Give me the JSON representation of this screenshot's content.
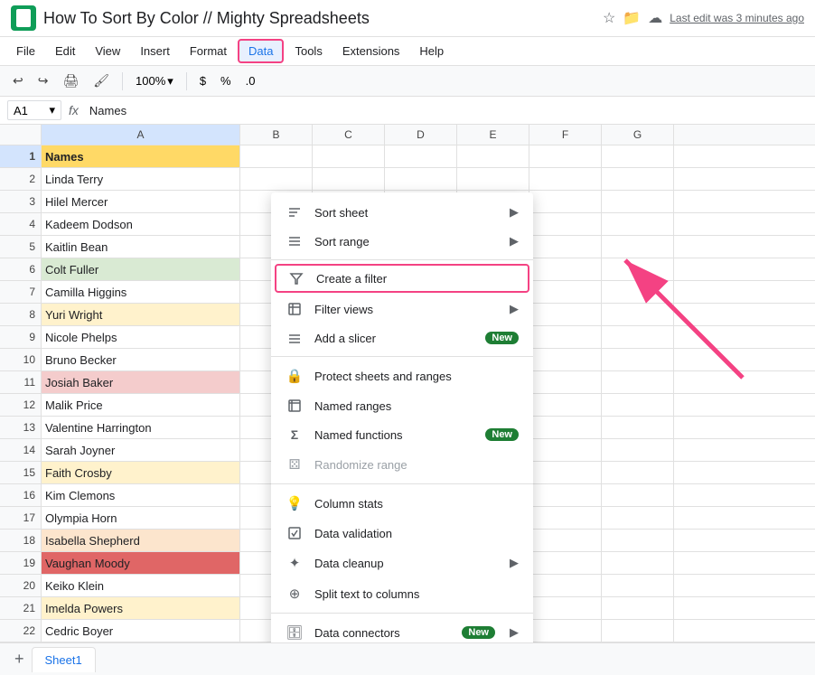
{
  "title": "How To Sort By Color // Mighty Spreadsheets",
  "lastEdit": "Last edit was 3 minutes ago",
  "menu": {
    "items": [
      "File",
      "Edit",
      "View",
      "Insert",
      "Format",
      "Data",
      "Tools",
      "Extensions",
      "Help"
    ],
    "activeItem": "Data"
  },
  "toolbar": {
    "zoom": "100%",
    "currency": "$",
    "percent": "%",
    "decimal": ".0"
  },
  "formulaBar": {
    "cellRef": "A1",
    "cellContent": "Names"
  },
  "columns": {
    "headers": [
      "A",
      "B",
      "C",
      "D",
      "E",
      "F",
      "G"
    ]
  },
  "rows": [
    {
      "num": 1,
      "a": "Names",
      "color": "header"
    },
    {
      "num": 2,
      "a": "Linda Terry",
      "color": ""
    },
    {
      "num": 3,
      "a": "Hilel Mercer",
      "color": ""
    },
    {
      "num": 4,
      "a": "Kadeem Dodson",
      "color": ""
    },
    {
      "num": 5,
      "a": "Kaitlin Bean",
      "color": ""
    },
    {
      "num": 6,
      "a": "Colt Fuller",
      "color": "green"
    },
    {
      "num": 7,
      "a": "Camilla Higgins",
      "color": ""
    },
    {
      "num": 8,
      "a": "Yuri Wright",
      "color": "yellow"
    },
    {
      "num": 9,
      "a": "Nicole Phelps",
      "color": ""
    },
    {
      "num": 10,
      "a": "Bruno Becker",
      "color": ""
    },
    {
      "num": 11,
      "a": "Josiah Baker",
      "color": "salmon"
    },
    {
      "num": 12,
      "a": "Malik Price",
      "color": ""
    },
    {
      "num": 13,
      "a": "Valentine Harrington",
      "color": ""
    },
    {
      "num": 14,
      "a": "Sarah Joyner",
      "color": ""
    },
    {
      "num": 15,
      "a": "Faith Crosby",
      "color": "yellow"
    },
    {
      "num": 16,
      "a": "Kim Clemons",
      "color": ""
    },
    {
      "num": 17,
      "a": "Olympia Horn",
      "color": ""
    },
    {
      "num": 18,
      "a": "Isabella Shepherd",
      "color": "orange"
    },
    {
      "num": 19,
      "a": "Vaughan Moody",
      "color": "red"
    },
    {
      "num": 20,
      "a": "Keiko Klein",
      "color": ""
    },
    {
      "num": 21,
      "a": "Imelda Powers",
      "color": "yellow"
    },
    {
      "num": 22,
      "a": "Cedric Boyer",
      "color": ""
    }
  ],
  "dropdownMenu": {
    "items": [
      {
        "id": "sort-sheet",
        "icon": "↕",
        "label": "Sort sheet",
        "hasArrow": true
      },
      {
        "id": "sort-range",
        "icon": "↕",
        "label": "Sort range",
        "hasArrow": true
      },
      {
        "id": "divider1"
      },
      {
        "id": "create-filter",
        "icon": "▼",
        "label": "Create a filter",
        "highlighted": true
      },
      {
        "id": "filter-views",
        "icon": "⊞",
        "label": "Filter views",
        "hasArrow": true
      },
      {
        "id": "add-slicer",
        "icon": "≡",
        "label": "Add a slicer",
        "badge": "New"
      },
      {
        "id": "divider2"
      },
      {
        "id": "protect-sheets",
        "icon": "🔒",
        "label": "Protect sheets and ranges"
      },
      {
        "id": "named-ranges",
        "icon": "⊞",
        "label": "Named ranges"
      },
      {
        "id": "named-functions",
        "icon": "Σ",
        "label": "Named functions",
        "badge": "New"
      },
      {
        "id": "randomize-range",
        "icon": "⚄",
        "label": "Randomize range",
        "disabled": true
      },
      {
        "id": "divider3"
      },
      {
        "id": "column-stats",
        "icon": "💡",
        "label": "Column stats"
      },
      {
        "id": "data-validation",
        "icon": "⊞",
        "label": "Data validation"
      },
      {
        "id": "data-cleanup",
        "icon": "✦",
        "label": "Data cleanup",
        "hasArrow": true
      },
      {
        "id": "split-text",
        "icon": "⊕",
        "label": "Split text to columns"
      },
      {
        "id": "divider4"
      },
      {
        "id": "data-connectors",
        "icon": "🗄",
        "label": "Data connectors",
        "badge": "New",
        "hasArrow": true
      }
    ]
  },
  "sheetTab": "Sheet1",
  "colors": {
    "orange": "#fce5cd",
    "green": "#d9ead3",
    "red": "#ea9999",
    "yellow": "#fff2cc",
    "salmon": "#e06666",
    "highlight": "#f44283",
    "newBadge": "#1e7e34"
  }
}
